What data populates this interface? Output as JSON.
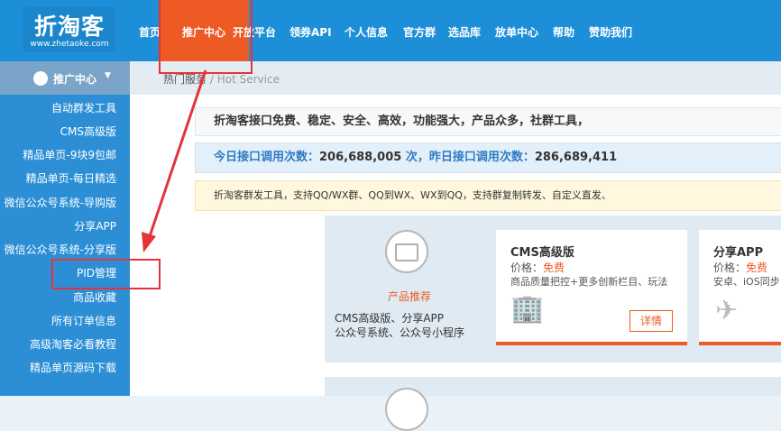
{
  "logo": {
    "title": "折淘客",
    "domain": "www.zhetaoke.com"
  },
  "nav": [
    "首页",
    "推广中心",
    "开放平台",
    "领券API",
    "个人信息",
    "官方群",
    "选品库",
    "放单中心",
    "帮助",
    "赞助我们"
  ],
  "sidebar": {
    "header": "推广中心",
    "items": [
      "自动群发工具",
      "CMS高级版",
      "精品单页-9块9包邮",
      "精品单页-每日精选",
      "微信公众号系统-导购版",
      "分享APP",
      "微信公众号系统-分享版",
      "PID管理",
      "商品收藏",
      "所有订单信息",
      "高级淘客必看教程",
      "精品单页源码下载"
    ]
  },
  "breadcrumb": {
    "link": "热门服务",
    "separator": "/",
    "current": "Hot Service"
  },
  "notices": {
    "features": "折淘客接口免费、稳定、安全、高效，功能强大，产品众多，社群工具，",
    "stats_prefix": "今日接口调用次数：",
    "today_count": "206,688,005",
    "stats_mid": " 次，昨日接口调用次数：",
    "yesterday_count": "286,689,411",
    "tools": "折淘客群发工具，支持QQ/WX群、QQ到WX、WX到QQ，支持群复制转发、自定义直发、"
  },
  "products_panel": {
    "label": "产品推荐",
    "line1": "CMS高级版、分享APP",
    "line2": "公众号系统、公众号小程序"
  },
  "cards": [
    {
      "title": "CMS高级版",
      "price_label": "价格：",
      "price": "免费",
      "desc": "商品质量把控+更多创新栏目、玩法",
      "button": "详情",
      "illustration": "building-icon"
    },
    {
      "title": "分享APP",
      "price_label": "价格：",
      "price": "免费",
      "desc": "安卓、iOS同步",
      "illustration": "airplane-icon"
    }
  ],
  "colors": {
    "topbar": "#1c8fd8",
    "accent": "#ee5a24",
    "sidebar": "#2c8fd6",
    "highlight": "#e5333a"
  }
}
